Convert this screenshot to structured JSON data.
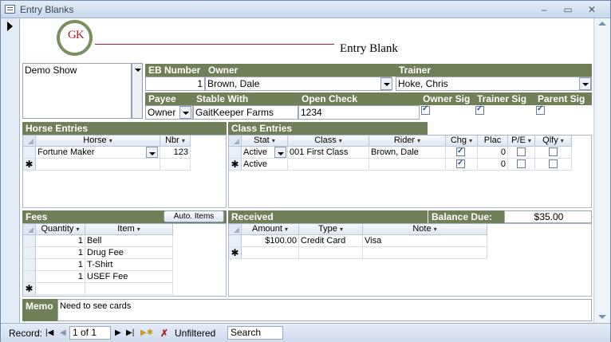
{
  "window": {
    "title": "Entry Blanks",
    "minimize": "–",
    "restore": "▭",
    "close": "✕"
  },
  "header": {
    "logo_text": "GK",
    "title": "Entry Blank"
  },
  "show": {
    "name": "Demo Show"
  },
  "labels": {
    "eb_number": "EB Number",
    "owner": "Owner",
    "trainer": "Trainer",
    "payee": "Payee",
    "stable_with": "Stable With",
    "open_check": "Open Check",
    "owner_sig": "Owner Sig",
    "trainer_sig": "Trainer Sig",
    "parent_sig": "Parent Sig",
    "horse_entries": "Horse Entries",
    "class_entries": "Class Entries",
    "fees": "Fees",
    "received": "Received",
    "balance_due": "Balance Due:",
    "memo": "Memo"
  },
  "fields": {
    "eb_number": "1",
    "owner": "Brown, Dale",
    "trainer": "Hoke, Chris",
    "payee": "Owner",
    "stable_with": "GaitKeeper Farms",
    "open_check": "1234",
    "owner_sig": true,
    "trainer_sig": true,
    "parent_sig": true,
    "balance_due": "$35.00",
    "memo": "Need to see cards"
  },
  "horse_entries": {
    "columns": [
      "Horse",
      "Nbr"
    ],
    "rows": [
      {
        "horse": "Fortune Maker",
        "nbr": "123"
      }
    ],
    "new_row_marker": "✱"
  },
  "class_entries": {
    "columns": [
      "Stat",
      "Class",
      "Rider",
      "Chg",
      "Plac",
      "P/E",
      "Qlfy"
    ],
    "rows": [
      {
        "stat": "Active",
        "class": "001 First Class",
        "rider": "Brown, Dale",
        "chg": true,
        "plac": "0",
        "pe": false,
        "qlfy": false
      },
      {
        "stat": "Active",
        "class": "",
        "rider": "",
        "chg": true,
        "plac": "0",
        "pe": false,
        "qlfy": false
      }
    ],
    "new_row_marker": "✱"
  },
  "fees": {
    "auto_items_button": "Auto. Items",
    "columns": [
      "Quantity",
      "Item"
    ],
    "rows": [
      {
        "qty": "1",
        "item": "Bell"
      },
      {
        "qty": "1",
        "item": "Drug Fee"
      },
      {
        "qty": "1",
        "item": "T-Shirt"
      },
      {
        "qty": "1",
        "item": "USEF Fee"
      }
    ],
    "new_row_marker": "✱"
  },
  "received": {
    "columns": [
      "Amount",
      "Type",
      "Note"
    ],
    "rows": [
      {
        "amount": "$100.00",
        "type": "Credit Card",
        "note": "Visa"
      }
    ],
    "new_row_marker": "✱"
  },
  "statusbar": {
    "record_label": "Record:",
    "record_value": "1 of 1",
    "filter": "Unfiltered",
    "search": "Search"
  },
  "colors": {
    "section_header": "#6f7f57",
    "logo_red": "#b21e28"
  }
}
